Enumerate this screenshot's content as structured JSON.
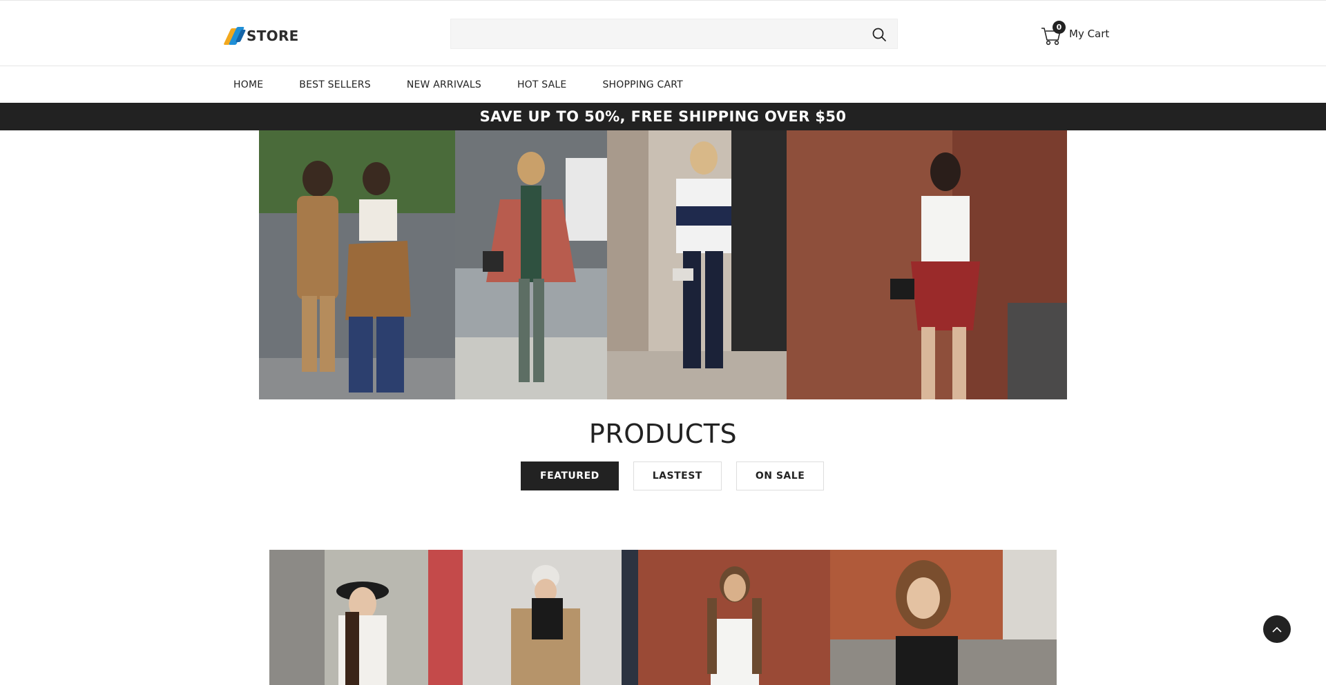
{
  "header": {
    "logo_text": "STORE",
    "search": {
      "value": "",
      "placeholder": ""
    },
    "cart": {
      "count": "0",
      "label": "My Cart"
    }
  },
  "nav": {
    "items": [
      {
        "label": "HOME"
      },
      {
        "label": "BEST SELLERS"
      },
      {
        "label": "NEW ARRIVALS"
      },
      {
        "label": "HOT SALE"
      },
      {
        "label": "SHOPPING CART"
      }
    ]
  },
  "promo": {
    "text": "SAVE UP TO 50%, FREE SHIPPING OVER $50"
  },
  "products": {
    "title": "PRODUCTS",
    "tabs": [
      {
        "label": "FEATURED",
        "active": true
      },
      {
        "label": "LASTEST",
        "active": false
      },
      {
        "label": "ON SALE",
        "active": false
      }
    ]
  },
  "colors": {
    "primary": "#222222",
    "promo_bg": "#222222",
    "search_bg": "#f5f5f5",
    "border": "#dddddd",
    "logo_orange": "#f2a81d",
    "logo_blue": "#1f8fd6"
  },
  "icons": {
    "search": "search-icon",
    "cart": "cart-icon",
    "back_to_top": "chevron-up-icon"
  }
}
